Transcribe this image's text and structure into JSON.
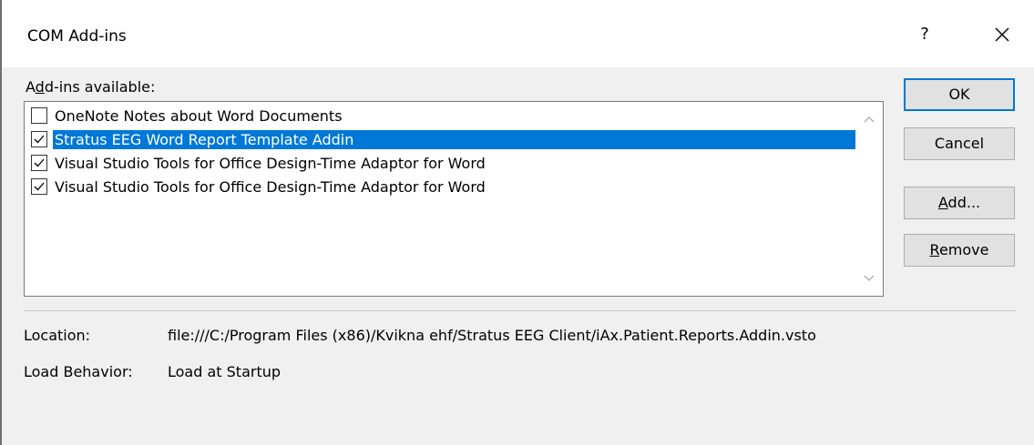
{
  "dialog": {
    "title": "COM Add-ins",
    "help_label": "?",
    "close_icon": "close-icon"
  },
  "addins": {
    "label_prefix": "A",
    "label_accel": "d",
    "label_rest": "d-ins available:",
    "items": [
      {
        "label": "OneNote Notes about Word Documents",
        "checked": false,
        "selected": false
      },
      {
        "label": "Stratus EEG Word Report Template Addin",
        "checked": true,
        "selected": true
      },
      {
        "label": "Visual Studio Tools for Office Design-Time Adaptor for Word",
        "checked": true,
        "selected": false
      },
      {
        "label": "Visual Studio Tools for Office Design-Time Adaptor for Word",
        "checked": true,
        "selected": false
      }
    ]
  },
  "buttons": {
    "ok": "OK",
    "cancel": "Cancel",
    "add_accel": "A",
    "add_rest": "dd...",
    "remove_accel": "R",
    "remove_rest": "emove"
  },
  "details": {
    "location_label": "Location:",
    "location_value": "file:///C:/Program Files (x86)/Kvikna ehf/Stratus EEG Client/iAx.Patient.Reports.Addin.vsto",
    "load_label": "Load Behavior:",
    "load_value": "Load at Startup"
  },
  "colors": {
    "selection": "#0078d7",
    "default_button_border": "#0078d7",
    "button_face": "#e1e1e1",
    "dialog_face": "#f0f0f0"
  }
}
